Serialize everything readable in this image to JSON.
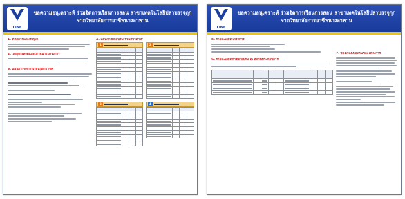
{
  "left": {
    "banner": {
      "title_line1": "ขอความอนุเคราะห์ ร่วมจัดการเรียนการสอน สาขาเทคโนโลยีปลาบรรจุกุก",
      "title_line2": "จากวิทยาลัยการอาชีพนางลาพาน",
      "logo_text": "LINE"
    },
    "sections": {
      "s1": "1. หลักการและเหตุผล",
      "s2": "2. วัตถุประสงค์และเป้าหมายโครงการ",
      "s3": "3. แผนการจัดการเรียนรู้ฝึกอาชีพ",
      "s4": "4. แผนการฝึกอบรม ร่วมกับวิสาหกิจ"
    },
    "boxes": {
      "b1_num": "1",
      "b2_num": "2",
      "b3_num": "3"
    }
  },
  "right": {
    "banner": {
      "title_line1": "ขอความอนุเคราะห์ ร่วมจัดการเรียนการสอน สาขาเทคโนโลยีปลาบรรจุกุก",
      "title_line2": "จากวิทยาลัยการอาชีพนางลาพาน",
      "logo_text": "LINE"
    },
    "sections": {
      "s5": "5. รายละเอียดโครงการ",
      "s6": "6. รายละเอียดการฝึกอบรม ณ สถานประกอบการ",
      "s7": "7. ข้อตกลงเบื้องต้นของโครงการ"
    }
  },
  "colors": {
    "banner": "#1b3f9f",
    "stripe": "#f1c400",
    "heading": "#c41d1d",
    "box_header": "#f3d38a"
  }
}
